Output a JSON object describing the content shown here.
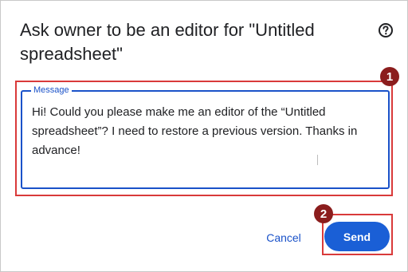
{
  "dialog": {
    "title": "Ask owner to be an editor for \"Untitled spreadsheet\"",
    "help_icon": "help-circle-icon"
  },
  "message_field": {
    "label": "Message",
    "value": "Hi! Could you please make me an editor of the “Untitled spreadsheet”? I need to restore a previous version. Thanks in advance!"
  },
  "actions": {
    "cancel_label": "Cancel",
    "send_label": "Send"
  },
  "annotations": {
    "badge_1": "1",
    "badge_2": "2"
  },
  "colors": {
    "accent": "#1a5fd6",
    "focus_border": "#1a52c9",
    "annotation_red": "#d93a3a",
    "badge_dark_red": "#8b1d1d"
  }
}
